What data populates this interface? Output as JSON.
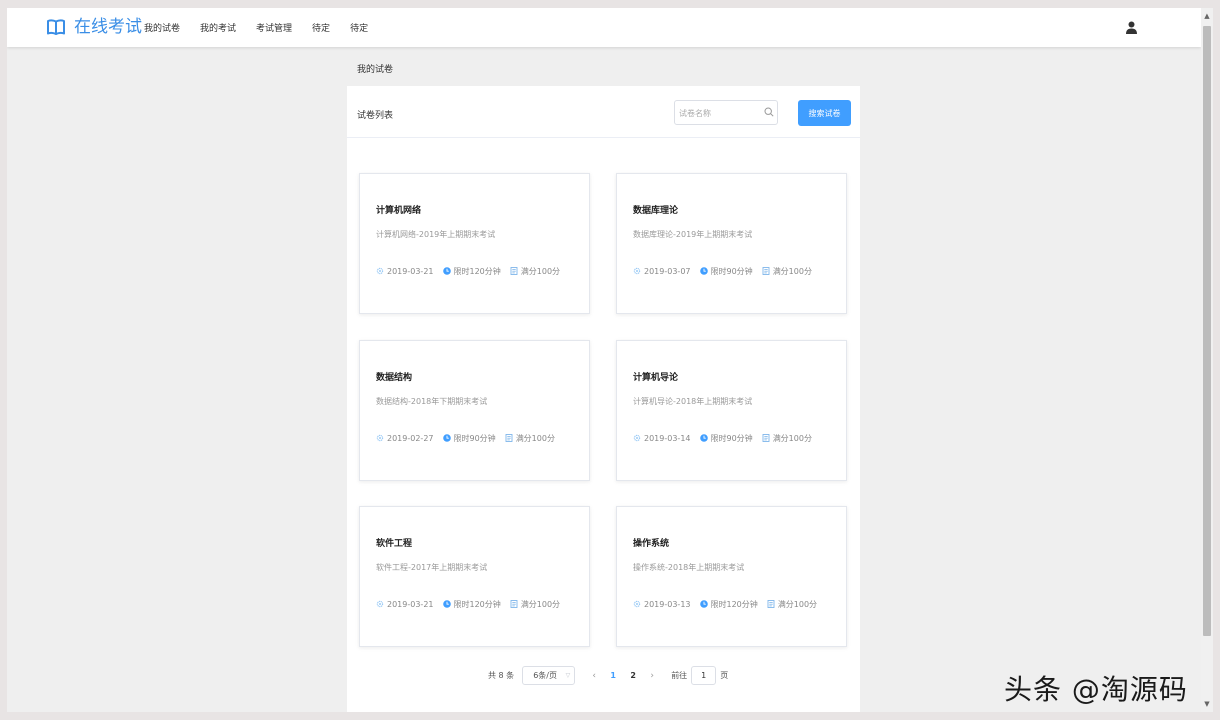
{
  "app": {
    "title": "在线考试",
    "nav": [
      "我的试卷",
      "我的考试",
      "考试管理",
      "待定",
      "待定"
    ]
  },
  "breadcrumb": "我的试卷",
  "panel": {
    "title": "试卷列表",
    "search_placeholder": "试卷名称",
    "search_button": "搜索试卷"
  },
  "papers": [
    {
      "title": "计算机网络",
      "desc": "计算机网络-2019年上期期末考试",
      "date": "2019-03-21",
      "time_limit": "限时120分钟",
      "full_score": "满分100分"
    },
    {
      "title": "数据库理论",
      "desc": "数据库理论-2019年上期期末考试",
      "date": "2019-03-07",
      "time_limit": "限时90分钟",
      "full_score": "满分100分"
    },
    {
      "title": "数据结构",
      "desc": "数据结构-2018年下期期末考试",
      "date": "2019-02-27",
      "time_limit": "限时90分钟",
      "full_score": "满分100分"
    },
    {
      "title": "计算机导论",
      "desc": "计算机导论-2018年上期期末考试",
      "date": "2019-03-14",
      "time_limit": "限时90分钟",
      "full_score": "满分100分"
    },
    {
      "title": "软件工程",
      "desc": "软件工程-2017年上期期末考试",
      "date": "2019-03-21",
      "time_limit": "限时120分钟",
      "full_score": "满分100分"
    },
    {
      "title": "操作系统",
      "desc": "操作系统-2018年上期期末考试",
      "date": "2019-03-13",
      "time_limit": "限时120分钟",
      "full_score": "满分100分"
    }
  ],
  "pagination": {
    "total": "共 8 条",
    "page_size": "6条/页",
    "pages": [
      "1",
      "2"
    ],
    "current": "1",
    "goto_label": "前往",
    "goto_value": "1",
    "page_suffix": "页"
  },
  "watermark": "头条 @淘源码",
  "colors": {
    "accent": "#409eff",
    "logo": "#3a8ee6"
  },
  "icons": {
    "logo": "open-book-icon",
    "user": "user-icon",
    "search": "search-icon",
    "date": "gear-icon",
    "time": "clock-icon",
    "score": "document-icon"
  }
}
